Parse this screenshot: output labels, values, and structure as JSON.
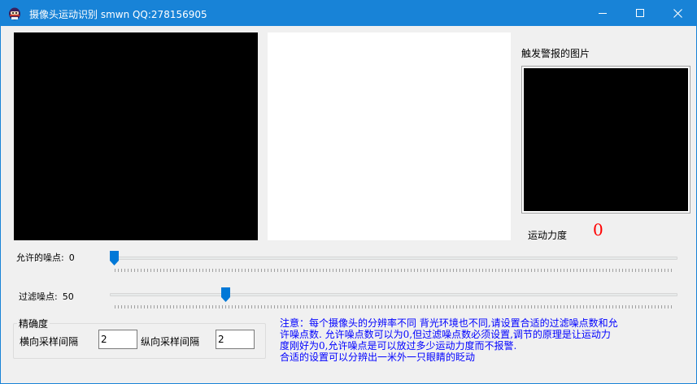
{
  "window": {
    "title": "摄像头运动识别 smwn QQ:278156905",
    "icon": "ninja-app-icon",
    "controls": {
      "minimize": "minimize-icon",
      "maximize": "maximize-icon",
      "close": "close-icon"
    }
  },
  "alarm": {
    "label": "触发警报的图片"
  },
  "force": {
    "label": "运动力度",
    "value": "0",
    "value_color": "#ff0000"
  },
  "sliders": {
    "noise": {
      "label": "允许的噪点:",
      "value": "0",
      "position_percent": 0
    },
    "filter": {
      "label": "过滤噪点:",
      "value": "50",
      "position_percent": 20
    }
  },
  "precision": {
    "title": "精确度",
    "horizontal_label": "横向采样间隔",
    "horizontal_value": "2",
    "vertical_label": "纵向采样间隔",
    "vertical_value": "2"
  },
  "note": {
    "lines": [
      "注意：每个摄像头的分辨率不同 背光环境也不同,请设置合适的过滤噪点数和允",
      "许噪点数. 允许噪点数可以为0,但过滤噪点数必须设置,调节的原理是让运动力",
      "度刚好为0,允许噪点是可以放过多少运动力度而不报警.",
      "合适的设置可以分辨出一米外一只眼睛的眨动"
    ],
    "color": "#0000ff"
  },
  "colors": {
    "titlebar": "#1883d7",
    "thumb": "#0078d7"
  }
}
